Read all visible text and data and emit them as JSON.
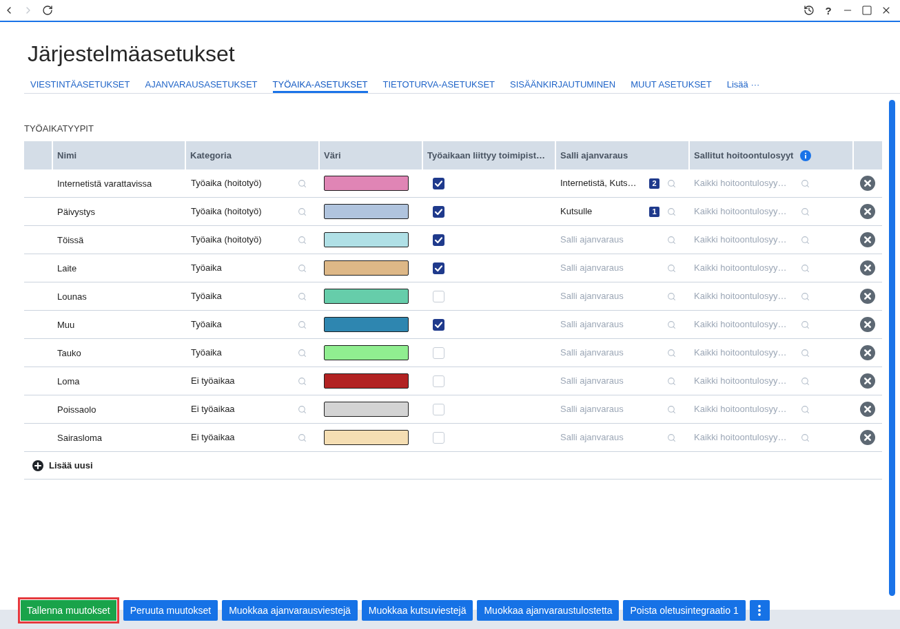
{
  "title_bar": {
    "nav": [
      {
        "kind": "back",
        "disabled": false
      },
      {
        "kind": "forward",
        "disabled": true
      },
      {
        "kind": "reload",
        "disabled": false
      }
    ],
    "help": "?"
  },
  "page_title": "Järjestelmäasetukset",
  "tabs": [
    {
      "label": "VIESTINTÄASETUKSET",
      "selected": false
    },
    {
      "label": "AJANVARAUSASETUKSET",
      "selected": false
    },
    {
      "label": "TYÖAIKA-ASETUKSET",
      "selected": true
    },
    {
      "label": "TIETOTURVA-ASETUKSET",
      "selected": false
    },
    {
      "label": "SISÄÄNKIRJAUTUMINEN",
      "selected": false
    },
    {
      "label": "MUUT ASETUKSET",
      "selected": false
    }
  ],
  "tabs_more": "Lisää ···",
  "section_title": "TYÖAIKATYYPIT",
  "table": {
    "columns": [
      {
        "label": "Nimi",
        "info": false
      },
      {
        "label": "Kategoria",
        "info": false
      },
      {
        "label": "Väri",
        "info": false
      },
      {
        "label": "Työaikaan liittyy toimipist…",
        "info": false
      },
      {
        "label": "Salli ajanvaraus",
        "info": false
      },
      {
        "label": "Sallitut hoitoontulosyyt",
        "info": true
      }
    ],
    "rows": [
      {
        "name": "Internetistä varattavissa",
        "category": "Työaika (hoitotyö)",
        "color": "#e085b5",
        "checked": true,
        "booking": {
          "value": "Internetistä, Kuts…",
          "count": "2"
        },
        "reasons": {
          "placeholder": "Kaikki hoitoontulosyy…"
        }
      },
      {
        "name": "Päivystys",
        "category": "Työaika (hoitotyö)",
        "color": "#b0c4de",
        "checked": true,
        "booking": {
          "value": "Kutsulle",
          "count": "1"
        },
        "reasons": {
          "placeholder": "Kaikki hoitoontulosyy…"
        }
      },
      {
        "name": "Töissä",
        "category": "Työaika (hoitotyö)",
        "color": "#b0e0e6",
        "checked": true,
        "booking": {
          "placeholder": "Salli ajanvaraus"
        },
        "reasons": {
          "placeholder": "Kaikki hoitoontulosyy…"
        }
      },
      {
        "name": "Laite",
        "category": "Työaika",
        "color": "#deb887",
        "checked": true,
        "booking": {
          "placeholder": "Salli ajanvaraus"
        },
        "reasons": {
          "placeholder": "Kaikki hoitoontulosyy…"
        }
      },
      {
        "name": "Lounas",
        "category": "Työaika",
        "color": "#66cdaa",
        "checked": false,
        "booking": {
          "placeholder": "Salli ajanvaraus"
        },
        "reasons": {
          "placeholder": "Kaikki hoitoontulosyy…"
        }
      },
      {
        "name": "Muu",
        "category": "Työaika",
        "color": "#2e86b0",
        "checked": true,
        "booking": {
          "placeholder": "Salli ajanvaraus"
        },
        "reasons": {
          "placeholder": "Kaikki hoitoontulosyy…"
        }
      },
      {
        "name": "Tauko",
        "category": "Työaika",
        "color": "#90ee90",
        "checked": false,
        "booking": {
          "placeholder": "Salli ajanvaraus"
        },
        "reasons": {
          "placeholder": "Kaikki hoitoontulosyy…"
        }
      },
      {
        "name": "Loma",
        "category": "Ei työaikaa",
        "color": "#b22222",
        "checked": false,
        "booking": {
          "placeholder": "Salli ajanvaraus"
        },
        "reasons": {
          "placeholder": "Kaikki hoitoontulosyy…"
        }
      },
      {
        "name": "Poissaolo",
        "category": "Ei työaikaa",
        "color": "#d3d3d3",
        "checked": false,
        "booking": {
          "placeholder": "Salli ajanvaraus"
        },
        "reasons": {
          "placeholder": "Kaikki hoitoontulosyy…"
        }
      },
      {
        "name": "Sairasloma",
        "category": "Ei työaikaa",
        "color": "#f5deb3",
        "checked": false,
        "booking": {
          "placeholder": "Salli ajanvaraus"
        },
        "reasons": {
          "placeholder": "Kaikki hoitoontulosyy…"
        }
      }
    ],
    "add_label": "Lisää uusi"
  },
  "actions": [
    {
      "kind": "save",
      "label": "Tallenna muutokset",
      "highlighted": true
    },
    {
      "kind": "default",
      "label": "Peruuta muutokset",
      "highlighted": false
    },
    {
      "kind": "default",
      "label": "Muokkaa ajanvarausviestejä",
      "highlighted": false
    },
    {
      "kind": "default",
      "label": "Muokkaa kutsuviestejä",
      "highlighted": false
    },
    {
      "kind": "default",
      "label": "Muokkaa ajanvaraustulostetta",
      "highlighted": false
    },
    {
      "kind": "default",
      "label": "Poista oletusintegraatio 1",
      "highlighted": false
    },
    {
      "kind": "more",
      "highlighted": false
    }
  ]
}
